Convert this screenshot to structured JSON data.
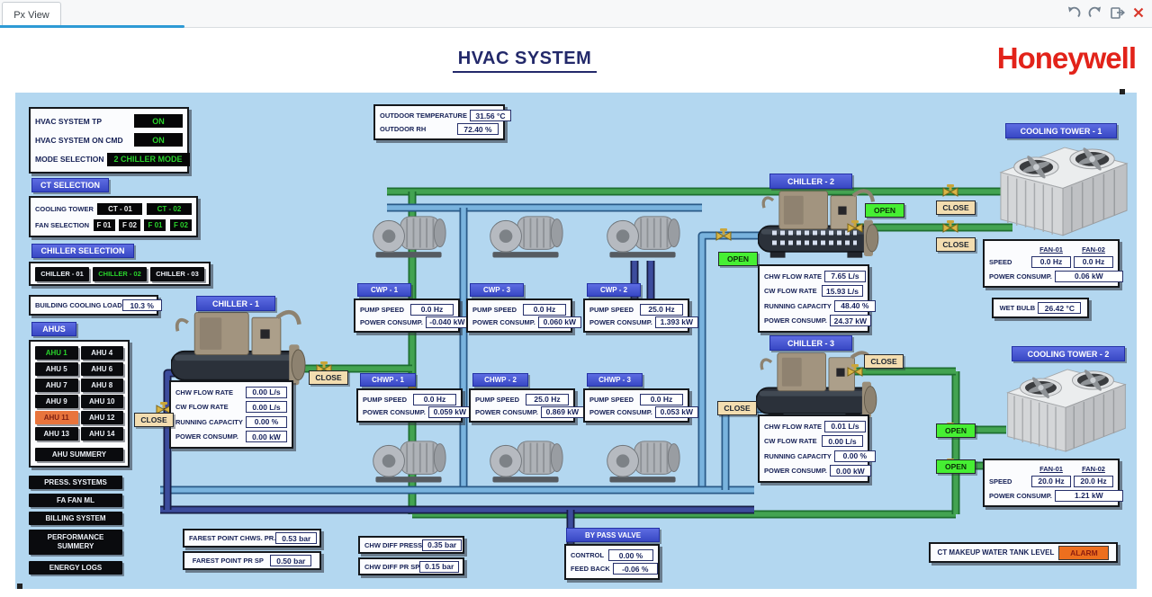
{
  "chrome": {
    "tab": "Px View"
  },
  "header": {
    "title": "HVAC SYSTEM",
    "brand": "Honeywell"
  },
  "colors": {
    "brand_red": "#e2231a",
    "lcd_green": "#29d32b",
    "header_blue": "#3f50cc",
    "open_green": "#46ef33",
    "close_tan": "#f3ddb0",
    "alarm_orange": "#ed6f1e",
    "mimic_bg": "#b3d7f0"
  },
  "status": {
    "rows": [
      {
        "label": "HVAC SYSTEM TP",
        "value": "ON"
      },
      {
        "label": "HVAC SYSTEM ON CMD",
        "value": "ON"
      },
      {
        "label": "MODE SELECTION",
        "value": "2 CHILLER MODE"
      }
    ]
  },
  "ct_selection": {
    "title": "CT SELECTION",
    "row1_label": "COOLING TOWER",
    "ct1": "CT - 01",
    "ct2": "CT - 02",
    "row2_label": "FAN SELECTION",
    "fans": [
      "F 01",
      "F 02",
      "F 01",
      "F 02"
    ]
  },
  "chiller_selection": {
    "title": "CHILLER SELECTION",
    "buttons": [
      "CHILLER - 01",
      "CHILLER - 02",
      "CHILLER - 03"
    ]
  },
  "building_cooling_load": {
    "label": "BUILDING COOLING LOAD",
    "value": "10.3 %"
  },
  "ahus": {
    "title": "AHUS",
    "buttons": [
      "AHU 1",
      "AHU 4",
      "AHU 5",
      "AHU 6",
      "AHU 7",
      "AHU 8",
      "AHU 9",
      "AHU 10",
      "AHU 11",
      "AHU 12",
      "AHU 13",
      "AHU 14"
    ],
    "summary": "AHU SUMMERY"
  },
  "nav": {
    "buttons": [
      "PRESS. SYSTEMS",
      "FA FAN ML",
      "BILLING SYSTEM",
      "PERFORMANCE SUMMERY",
      "ENERGY LOGS"
    ]
  },
  "outdoor": {
    "rows": [
      {
        "label": "OUTDOOR TEMPERATURE",
        "value": "31.56 °C"
      },
      {
        "label": "OUTDOOR RH",
        "value": "72.40 %"
      }
    ]
  },
  "chiller_labels": [
    "CHW FLOW RATE",
    "CW FLOW RATE",
    "RUNNING CAPACITY",
    "POWER CONSUMP."
  ],
  "chillers": [
    {
      "name": "CHILLER - 1",
      "values": [
        "0.00 L/s",
        "0.00 L/s",
        "0.00 %",
        "0.00 kW"
      ]
    },
    {
      "name": "CHILLER - 2",
      "values": [
        "7.65 L/s",
        "15.93 L/s",
        "48.40 %",
        "24.37 kW"
      ]
    },
    {
      "name": "CHILLER - 3",
      "values": [
        "0.01 L/s",
        "0.00 L/s",
        "0.00 %",
        "0.00 kW"
      ]
    }
  ],
  "pump_labels": {
    "speed": "PUMP SPEED",
    "power": "POWER CONSUMP."
  },
  "pumps": [
    {
      "name": "CWP - 1",
      "speed": "0.0 Hz",
      "power": "-0.040 kW"
    },
    {
      "name": "CWP - 3",
      "speed": "0.0 Hz",
      "power": "0.060 kW"
    },
    {
      "name": "CWP - 2",
      "speed": "25.0 Hz",
      "power": "1.393 kW"
    },
    {
      "name": "CHWP - 1",
      "speed": "0.0 Hz",
      "power": "0.059 kW"
    },
    {
      "name": "CHWP - 2",
      "speed": "25.0 Hz",
      "power": "0.869 kW"
    },
    {
      "name": "CHWP - 3",
      "speed": "0.0 Hz",
      "power": "0.053 kW"
    }
  ],
  "ct_labels": {
    "fan1": "FAN-01",
    "fan2": "FAN-02",
    "speed": "SPEED",
    "power": "POWER CONSUMP."
  },
  "cooling_towers": [
    {
      "name": "COOLING TOWER - 1",
      "speed1": "0.0 Hz",
      "speed2": "0.0 Hz",
      "power": "0.06 kW"
    },
    {
      "name": "COOLING TOWER - 2",
      "speed1": "20.0 Hz",
      "speed2": "20.0 Hz",
      "power": "1.21 kW"
    }
  ],
  "wet_bulb": {
    "label": "WET BULB",
    "value": "26.42 °C"
  },
  "farest": {
    "rows": [
      {
        "label": "FAREST POINT CHWS. PR.",
        "value": "0.53 bar"
      },
      {
        "label": "FAREST POINT PR SP",
        "value": "0.50 bar"
      }
    ]
  },
  "chw_diff": {
    "rows": [
      {
        "label": "CHW DIFF PRESS",
        "value": "0.35 bar"
      },
      {
        "label": "CHW DIFF PR SP",
        "value": "0.15 bar"
      }
    ]
  },
  "bypass": {
    "title": "BY PASS VALVE",
    "rows": [
      {
        "label": "CONTROL",
        "value": "0.00 %"
      },
      {
        "label": "FEED BACK",
        "value": "-0.06 %"
      }
    ]
  },
  "ct_makeup": {
    "label": "CT MAKEUP WATER TANK LEVEL",
    "value": "ALARM"
  },
  "valves": [
    "CLOSE",
    "CLOSE",
    "OPEN",
    "OPEN",
    "CLOSE",
    "CLOSE",
    "CLOSE",
    "CLOSE",
    "OPEN",
    "OPEN"
  ]
}
